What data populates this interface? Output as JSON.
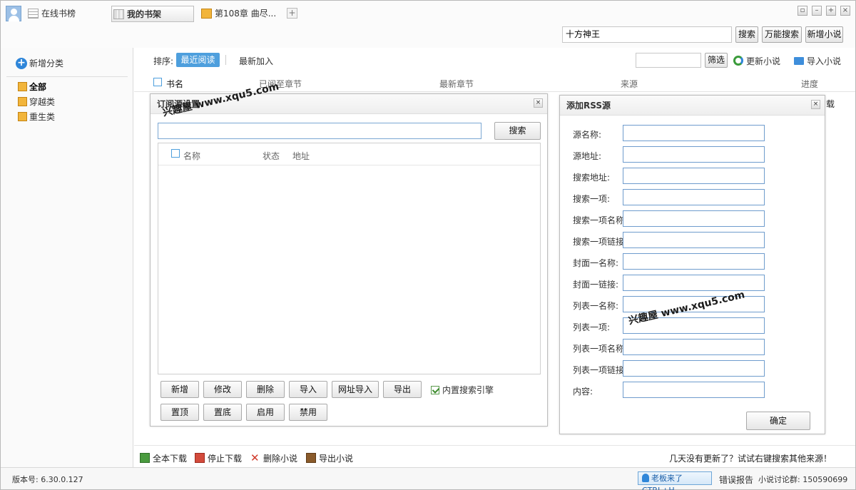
{
  "topbar": {
    "tabs": [
      {
        "label": "在线书榜",
        "icon": "list-icon"
      },
      {
        "label": "我的书架",
        "icon": "books-icon"
      },
      {
        "label": "第108章  曲尽...",
        "icon": "book-icon"
      }
    ],
    "add_tab": "+",
    "window_buttons": [
      "▫",
      "–",
      "+",
      "×"
    ],
    "search_value": "十方神王",
    "search_button": "搜索",
    "universal_search_button": "万能搜索",
    "add_novel_button": "新增小说"
  },
  "sidebar": {
    "add_category": "新增分类",
    "categories": [
      {
        "label": "全部",
        "active": true
      },
      {
        "label": "穿越类",
        "active": false
      },
      {
        "label": "重生类",
        "active": false
      }
    ]
  },
  "main": {
    "sort_label": "排序:",
    "sort_options": [
      "最近阅读",
      "最新加入"
    ],
    "filter_button": "筛选",
    "update_label": "更新小说",
    "import_label": "导入小说",
    "columns": [
      "书名",
      "已阅至章节",
      "最新章节",
      "来源",
      "进度"
    ],
    "row_fragment": "载",
    "bottom_actions": [
      "全本下载",
      "停止下载",
      "删除小说",
      "导出小说"
    ],
    "tip": "几天没有更新了？试试右键搜索其他来源！"
  },
  "statusbar": {
    "version": "版本号: 6.30.0.127",
    "boss_key": "老板来了CTRL+H",
    "report": "错误报告",
    "group": "小说讨论群: 150590699"
  },
  "sub_dialog": {
    "title": "订阅源设置",
    "close": "×",
    "search_button": "搜索",
    "list_columns": [
      "名称",
      "状态",
      "地址"
    ],
    "buttons_row1": [
      "新增",
      "修改",
      "删除",
      "导入",
      "网址导入",
      "导出"
    ],
    "buttons_row2": [
      "置顶",
      "置底",
      "启用",
      "禁用"
    ],
    "builtin_engine": "内置搜索引擎"
  },
  "rss_dialog": {
    "title": "添加RSS源",
    "close": "×",
    "fields": [
      "源名称:",
      "源地址:",
      "搜索地址:",
      "搜索一项:",
      "搜索一项名称:",
      "搜索一项链接:",
      "封面一名称:",
      "封面一链接:",
      "列表一名称:",
      "列表一项:",
      "列表一项名称:",
      "列表一项链接:",
      "内容:"
    ],
    "confirm": "确定"
  },
  "watermarks": [
    "兴趣屋 www.xqu5.com",
    "兴趣屋 www.xqu5.com"
  ]
}
